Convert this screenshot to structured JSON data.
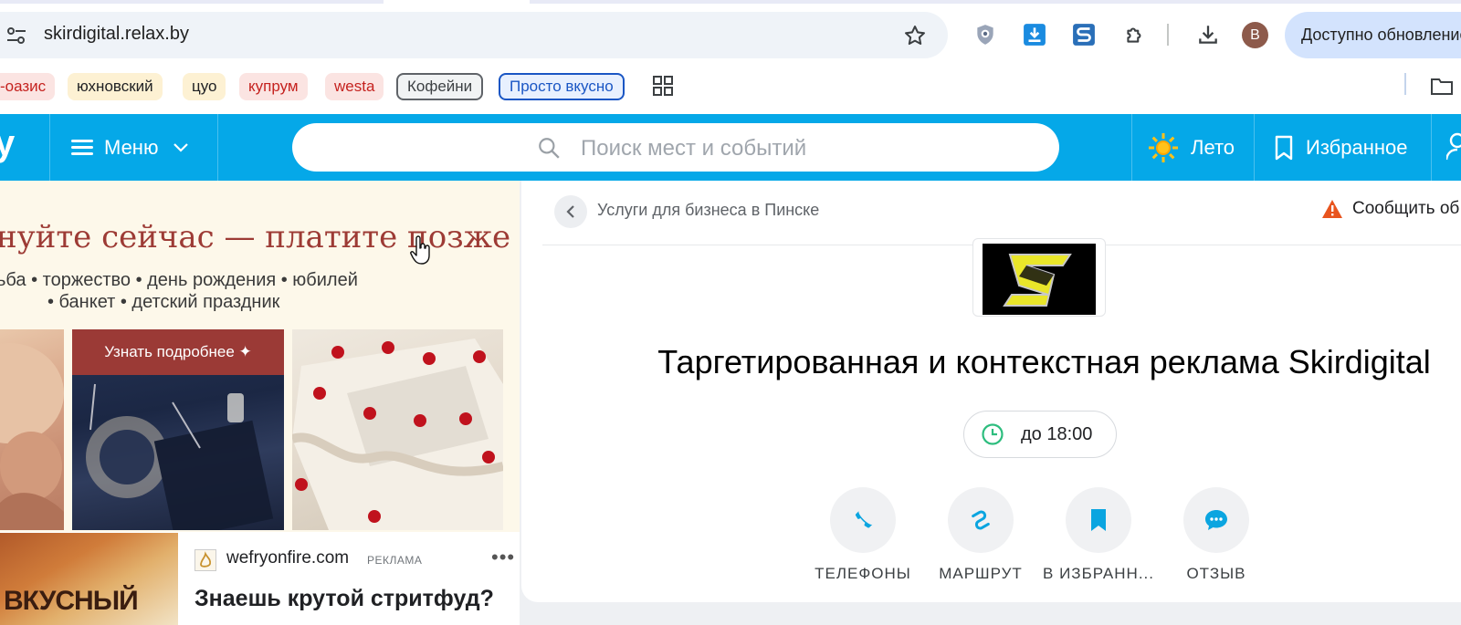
{
  "browser": {
    "url": "skirdigital.relax.by",
    "update_button": "Доступно обновление",
    "avatar_letter": "B"
  },
  "bookmarks": [
    {
      "label": "-оазис",
      "style": "red"
    },
    {
      "label": "юхновский",
      "style": "yellow"
    },
    {
      "label": "цуо",
      "style": "yellow"
    },
    {
      "label": "купрум",
      "style": "red"
    },
    {
      "label": "westa",
      "style": "red"
    },
    {
      "label": "Кофейни",
      "style": "grey"
    },
    {
      "label": "Просто вкусно",
      "style": "blue"
    }
  ],
  "header": {
    "logo_fragment": "y",
    "menu_label": "Меню",
    "search_placeholder": "Поиск мест и событий",
    "summer_label": "Лето",
    "favorites_label": "Избранное"
  },
  "ad": {
    "headline": "нуйте сейчас — платите позже",
    "line1": "ьба • торжество • день рождения • юбилей",
    "line2": "• банкет • детский праздник",
    "learn_more": "Узнать подробнее ✦",
    "food_text": "ВКУСНЫЙ",
    "advertiser_domain": "wefryonfire.com",
    "advertiser_tag": "РЕКЛАМА",
    "advertiser_title": "Знаешь крутой стритфуд?"
  },
  "card": {
    "breadcrumb": "Услуги для бизнеса в Пинске",
    "report": "Сообщить об",
    "company_name": "Таргетированная и контекстная реклама Skirdigital",
    "hours": "до 18:00",
    "actions": [
      {
        "label": "ТЕЛЕФОНЫ",
        "icon": "phone-icon"
      },
      {
        "label": "МАРШРУТ",
        "icon": "route-icon"
      },
      {
        "label": "В ИЗБРАНН...",
        "icon": "bookmark-icon"
      },
      {
        "label": "ОТЗЫВ",
        "icon": "comment-icon"
      }
    ]
  },
  "colors": {
    "header_blue": "#05a8e8",
    "accent_blue": "#0ba5e0",
    "ad_red": "#9b3a36",
    "hours_green": "#2dbd7e",
    "warning_orange": "#e8541e"
  }
}
